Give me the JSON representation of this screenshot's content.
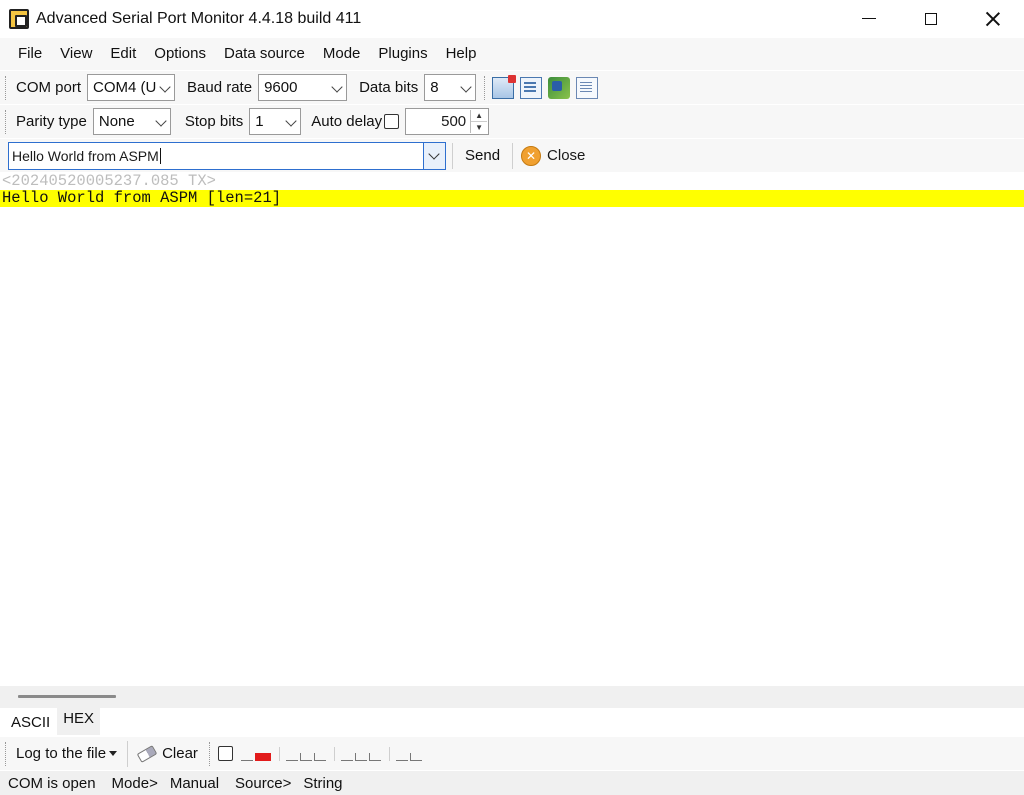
{
  "window": {
    "title": "Advanced Serial Port Monitor 4.4.18 build 411"
  },
  "menu": [
    "File",
    "View",
    "Edit",
    "Options",
    "Data source",
    "Mode",
    "Plugins",
    "Help"
  ],
  "toolbar1": {
    "com_port_label": "COM port",
    "com_port_value": "COM4 (U",
    "baud_rate_label": "Baud rate",
    "baud_rate_value": "9600",
    "data_bits_label": "Data bits",
    "data_bits_value": "8",
    "icons": [
      "monitor-icon",
      "document-icon",
      "plugin-icon",
      "page-icon"
    ]
  },
  "toolbar2": {
    "parity_label": "Parity type",
    "parity_value": "None",
    "stop_bits_label": "Stop bits",
    "stop_bits_value": "1",
    "auto_delay_label": "Auto delay",
    "auto_delay_checked": false,
    "delay_value": "500"
  },
  "toolbar3": {
    "send_text": "Hello World from ASPM",
    "send_label": "Send",
    "close_label": "Close"
  },
  "output": {
    "timestamp_line": "<20240520005237.085 TX>",
    "data_line": "Hello World from ASPM [len=21]",
    "highlight_color": "#ffff00"
  },
  "tabs": [
    "ASCII",
    "HEX"
  ],
  "active_tab": "HEX",
  "bottom_toolbar": {
    "log_label": "Log to the file",
    "clear_label": "Clear"
  },
  "status": {
    "port_state": "COM is open",
    "mode_label": "Mode>",
    "mode_value": "Manual",
    "source_label": "Source>",
    "source_value": "String"
  }
}
